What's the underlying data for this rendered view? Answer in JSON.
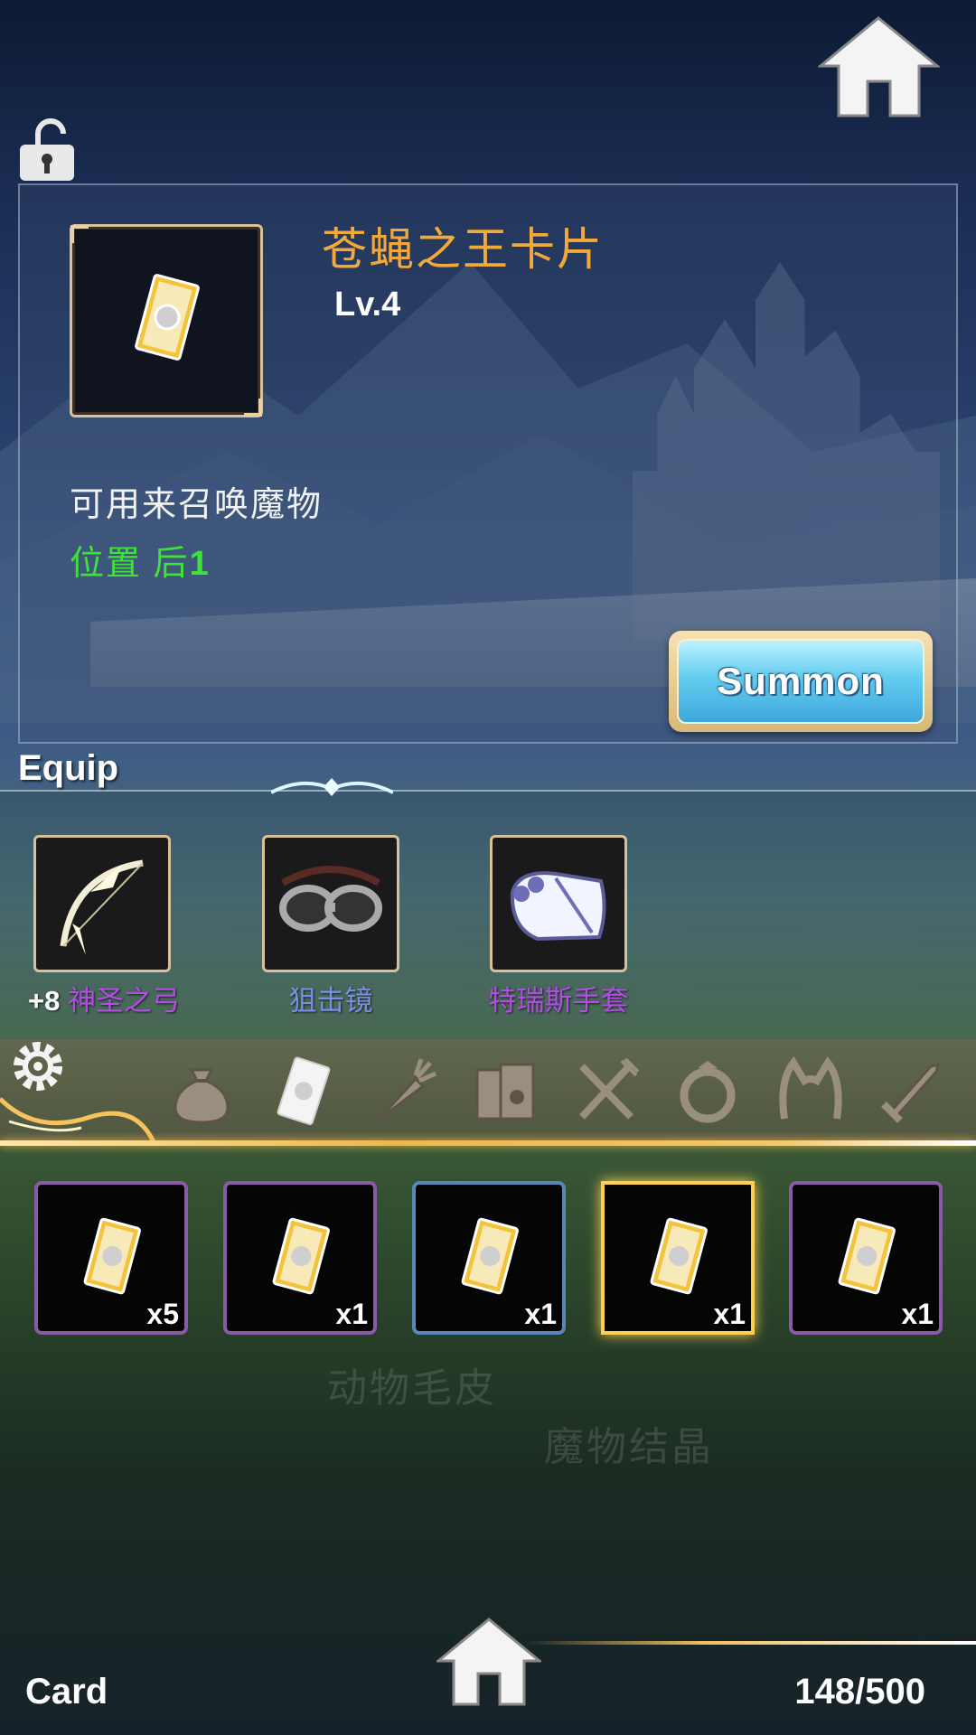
{
  "item": {
    "name": "苍蝇之王卡片",
    "level": "Lv.4",
    "description": "可用来召唤魔物",
    "position_label": "位置 后",
    "position_value": "1"
  },
  "summon_button": "Summon",
  "equip": {
    "title": "Equip",
    "slots": [
      {
        "plus": "+8",
        "name": "神圣之弓",
        "name_color": "#b04fe0",
        "icon": "bow-icon"
      },
      {
        "plus": "",
        "name": "狙击镜",
        "name_color": "#7a8fe8",
        "icon": "goggles-icon"
      },
      {
        "plus": "",
        "name": "特瑞斯手套",
        "name_color": "#b04fe0",
        "icon": "gauntlet-icon"
      }
    ]
  },
  "tabs": [
    {
      "icon": "bag-icon"
    },
    {
      "icon": "card-icon"
    },
    {
      "icon": "carrot-icon"
    },
    {
      "icon": "book-icon"
    },
    {
      "icon": "utensils-icon"
    },
    {
      "icon": "ring-icon"
    },
    {
      "icon": "headband-icon"
    },
    {
      "icon": "sword-icon"
    }
  ],
  "inventory": [
    {
      "count": "x5",
      "rarity": "purple"
    },
    {
      "count": "x1",
      "rarity": "purple"
    },
    {
      "count": "x1",
      "rarity": "blue"
    },
    {
      "count": "x1",
      "rarity": "gold"
    },
    {
      "count": "x1",
      "rarity": "purple"
    }
  ],
  "background_text": [
    "动物毛皮",
    "魔物结晶"
  ],
  "footer": {
    "category": "Card",
    "capacity": "148/500"
  },
  "colors": {
    "item_name": "#f2a83a",
    "position_text": "#3ee23a",
    "selected_border": "#ffcf52"
  }
}
